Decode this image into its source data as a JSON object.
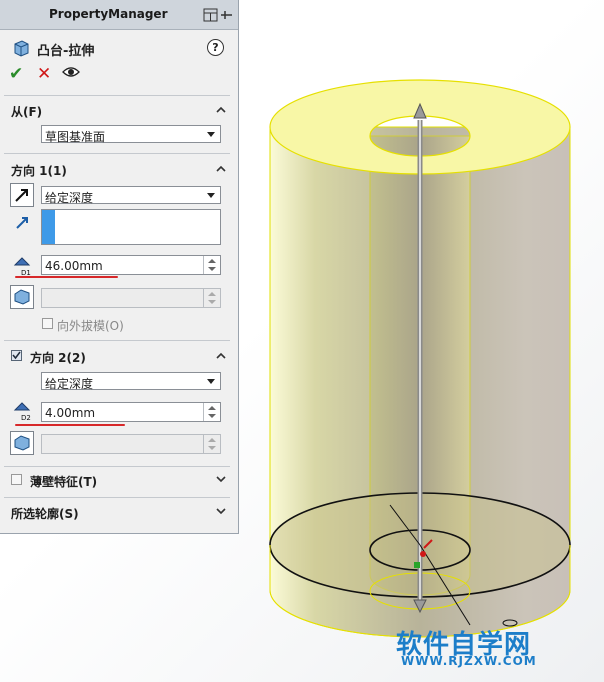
{
  "property_manager": {
    "title": "PropertyManager",
    "feature_name": "凸台-拉伸",
    "help": "?",
    "sections": {
      "from": {
        "label": "从(F)",
        "value": "草图基准面"
      },
      "direction1": {
        "label": "方向 1(1)",
        "end_condition": "给定深度",
        "depth": "46.00mm",
        "draft_label": "向外拔模(O)"
      },
      "direction2": {
        "label": "方向 2(2)",
        "end_condition": "给定深度",
        "depth": "4.00mm"
      },
      "thin_feature": {
        "label": "薄壁特征(T)"
      },
      "selected_contours": {
        "label": "所选轮廓(S)"
      }
    }
  },
  "watermark": {
    "line1": "软件自学网",
    "line2": "WWW.RJZXW.COM"
  },
  "colors": {
    "model_fill": "#e8e89c",
    "highlight": "#3e9ae8",
    "accent_red": "#d7282a",
    "watermark": "#1d7ec9"
  }
}
